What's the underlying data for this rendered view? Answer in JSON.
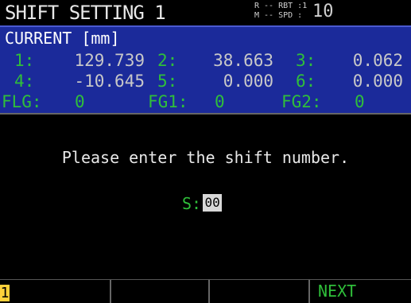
{
  "title": "SHIFT SETTING 1",
  "status": {
    "line1": "R -- RBT :1",
    "line2": "M -- SPD :",
    "value": "10"
  },
  "panel": {
    "header": "CURRENT [mm]",
    "rows": [
      [
        {
          "label": "1:",
          "value": "129.739"
        },
        {
          "label": "2:",
          "value": "38.663"
        },
        {
          "label": "3:",
          "value": "0.062"
        }
      ],
      [
        {
          "label": "4:",
          "value": "-10.645"
        },
        {
          "label": "5:",
          "value": "0.000"
        },
        {
          "label": "6:",
          "value": "0.000"
        }
      ],
      [
        {
          "label": "FLG:",
          "value": "0"
        },
        {
          "label": "FG1:",
          "value": "0"
        },
        {
          "label": "FG2:",
          "value": "0"
        }
      ]
    ]
  },
  "prompt": "Please enter the shift number.",
  "entry": {
    "label": "S:",
    "value": "00"
  },
  "fkeys": [
    "1",
    "",
    "",
    "NEXT"
  ],
  "colors": {
    "panel_bg": "#1b2a9a",
    "label_green": "#2fbf3a",
    "softkey_highlight": "#ffd13b"
  }
}
